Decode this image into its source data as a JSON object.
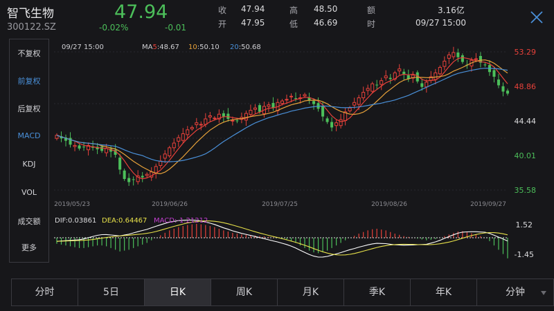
{
  "stock": {
    "name": "智飞生物",
    "code": "300122.SZ",
    "price": "47.94",
    "change_pct": "-0.02%",
    "change": "-0.01"
  },
  "quote": [
    {
      "label": "收",
      "value": "47.94"
    },
    {
      "label": "高",
      "value": "48.50"
    },
    {
      "label": "额",
      "value": "3.16亿"
    },
    {
      "label": "开",
      "value": "47.95"
    },
    {
      "label": "低",
      "value": "46.69"
    },
    {
      "label": "时",
      "value": "09/27 15:00"
    }
  ],
  "sidebar": [
    "不复权",
    "前复权",
    "后复权",
    "MACD",
    "KDJ",
    "VOL",
    "成交额",
    "更多"
  ],
  "sidebar_active": [
    "前复权",
    "MACD"
  ],
  "tabs": [
    "分时",
    "5日",
    "日K",
    "周K",
    "月K",
    "季K",
    "年K",
    "分钟"
  ],
  "active_tab": "日K",
  "icons": {
    "close": "close-icon",
    "dropdown": "triangle-down-icon"
  },
  "colors": {
    "up": "#e8413a",
    "down": "#4cbf5a",
    "ma5": "#e8413a",
    "ma10": "#e8a23a",
    "ma20": "#4a90d9",
    "dif": "#ffffff",
    "dea": "#e8e24a",
    "macd": "#c23fd0"
  },
  "chart_data": {
    "type": "candlestick",
    "date_label": "09/27 15:00",
    "ma": [
      {
        "name": "MA5",
        "period": "5",
        "value": "48.67"
      },
      {
        "name": "MA10",
        "period": "10",
        "value": "50.10"
      },
      {
        "name": "MA20",
        "period": "20",
        "value": "50.68"
      }
    ],
    "y_ticks": [
      "53.29",
      "48.86",
      "44.44",
      "40.01",
      "35.58"
    ],
    "ylim": [
      35.58,
      53.29
    ],
    "x_ticks": [
      "2019/05/23",
      "2019/06/26",
      "2019/07/25",
      "2019/08/26",
      "2019/09/27"
    ],
    "macd_labels": {
      "dif": "DIF:0.03861",
      "dea": "DEA:0.64467",
      "macd": "MACD:-1.21212"
    },
    "macd_ticks": [
      "1.52",
      "-1.45"
    ],
    "macd_ylim": [
      -1.45,
      1.52
    ],
    "close_series": [
      42.6,
      42.2,
      41.9,
      41.4,
      41.3,
      40.9,
      41.1,
      41.3,
      41.0,
      40.8,
      40.6,
      40.9,
      40.5,
      40.1,
      38.2,
      37.0,
      36.6,
      36.9,
      37.4,
      37.2,
      37.6,
      37.9,
      38.6,
      39.3,
      40.2,
      41.0,
      41.6,
      42.3,
      42.8,
      43.3,
      43.6,
      44.2,
      44.0,
      44.7,
      45.1,
      44.8,
      45.3,
      45.0,
      44.7,
      44.5,
      44.4,
      44.9,
      45.4,
      45.8,
      46.1,
      45.6,
      46.3,
      46.5,
      46.1,
      46.8,
      47.0,
      47.2,
      47.6,
      47.3,
      47.4,
      47.8,
      47.1,
      46.6,
      46.0,
      45.0,
      44.3,
      43.6,
      44.2,
      44.6,
      45.6,
      46.1,
      46.8,
      47.4,
      48.1,
      48.6,
      49.2,
      49.0,
      49.6,
      50.2,
      49.8,
      50.6,
      51.1,
      50.4,
      49.8,
      50.3,
      49.5,
      48.8,
      49.4,
      50.1,
      50.6,
      51.3,
      52.1,
      52.9,
      53.2,
      52.6,
      52.0,
      51.6,
      52.2,
      52.4,
      51.9,
      51.6,
      50.7,
      50.1,
      49.0,
      48.2,
      47.94
    ],
    "macd_histogram": [
      -0.35,
      -0.4,
      -0.45,
      -0.5,
      -0.55,
      -0.6,
      -0.6,
      -0.55,
      -0.5,
      -0.45,
      -0.45,
      -0.5,
      -0.6,
      -0.7,
      -0.8,
      -0.75,
      -0.7,
      -0.6,
      -0.5,
      -0.4,
      -0.3,
      -0.15,
      0.0,
      0.15,
      0.3,
      0.45,
      0.55,
      0.65,
      0.72,
      0.78,
      0.82,
      0.85,
      0.82,
      0.78,
      0.72,
      0.65,
      0.55,
      0.45,
      0.38,
      0.3,
      0.25,
      0.2,
      0.18,
      0.15,
      0.13,
      0.1,
      0.08,
      0.05,
      0.02,
      0.0,
      -0.05,
      -0.1,
      -0.18,
      -0.3,
      -0.45,
      -0.6,
      -0.75,
      -0.85,
      -0.9,
      -0.85,
      -0.75,
      -0.6,
      -0.45,
      -0.3,
      -0.15,
      0.0,
      0.12,
      0.25,
      0.35,
      0.45,
      0.52,
      0.55,
      0.5,
      0.45,
      0.35,
      0.25,
      0.18,
      0.1,
      0.05,
      0.0,
      -0.05,
      -0.1,
      -0.15,
      -0.12,
      -0.08,
      0.0,
      0.1,
      0.2,
      0.3,
      0.38,
      0.4,
      0.35,
      0.28,
      0.2,
      0.1,
      0.0,
      -0.2,
      -0.45,
      -0.7,
      -0.95,
      -1.2
    ]
  }
}
